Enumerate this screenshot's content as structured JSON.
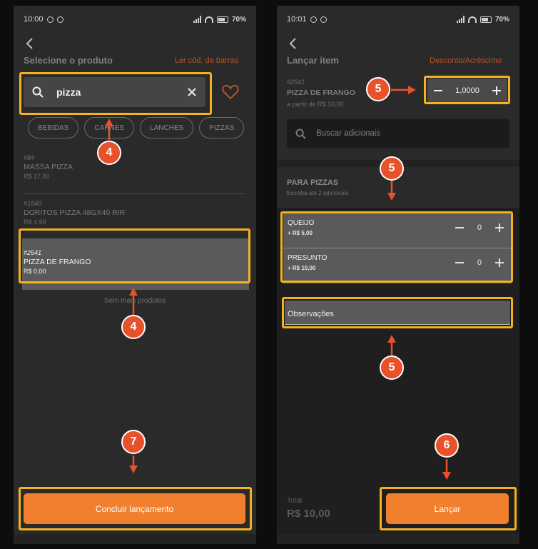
{
  "left_screen": {
    "status": {
      "time": "10:00",
      "battery": "70%"
    },
    "title": "Selecione o produto",
    "barcode_link": "Ler cód. de barras",
    "search": {
      "value": "pizza"
    },
    "categories": [
      "BEBIDAS",
      "CARNES",
      "LANCHES",
      "PIZZAS"
    ],
    "products": [
      {
        "code": "#84",
        "name": "MASSA PIZZA",
        "price": "R$ 17,80"
      },
      {
        "code": "#1840",
        "name": "DORITOS PIZZA 48GX40 RIR",
        "price": "R$ 4,99"
      },
      {
        "code": "#2541",
        "name": "PIZZA DE FRANGO",
        "price": "R$ 0,00"
      }
    ],
    "no_more": "Sem mais produtos",
    "conclude_button": "Concluir lançamento"
  },
  "right_screen": {
    "status": {
      "time": "10:01",
      "battery": "70%"
    },
    "title": "Lançar item",
    "discount_link": "Desconto/Acréscimo",
    "item": {
      "code": "#2541",
      "name": "PIZZA DE FRANGO",
      "from_price": "a partir de R$ 10,00"
    },
    "quantity": "1,0000",
    "addon_search_placeholder": "Buscar adicionais",
    "group": {
      "title": "PARA PIZZAS",
      "subtitle": "Escolha até 2 adicionais"
    },
    "addons": [
      {
        "name": "QUEIJO",
        "price": "+ R$ 5,00",
        "count": "0"
      },
      {
        "name": "PRESUNTO",
        "price": "+ R$ 10,00",
        "count": "0"
      }
    ],
    "observations": "Observações",
    "total_label": "Total",
    "total_value": "R$ 10,00",
    "submit_button": "Lançar"
  },
  "annotations": {
    "search": "4",
    "selected_product": "4",
    "quantity": "5",
    "addons": "5",
    "observations": "5",
    "submit": "6",
    "conclude": "7"
  },
  "colors": {
    "accent": "#f07f2e",
    "highlight": "#f6b21e",
    "badge": "#e8512a",
    "link": "#b4542a"
  },
  "icons": [
    "back-arrow-icon",
    "search-icon",
    "clear-icon",
    "heart-icon",
    "minus-icon",
    "plus-icon",
    "signal-icon",
    "wifi-icon",
    "battery-icon"
  ]
}
